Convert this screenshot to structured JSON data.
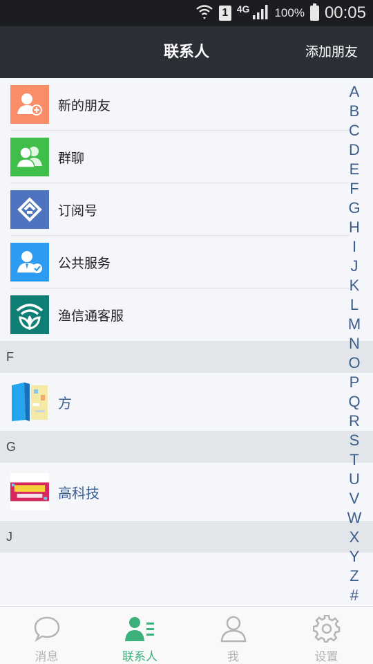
{
  "status_bar": {
    "network": "4G",
    "sim_slot": "1",
    "battery": "100%",
    "time": "00:05"
  },
  "header": {
    "title": "联系人",
    "add_friend_label": "添加朋友"
  },
  "special_items": [
    {
      "label": "新的朋友",
      "icon": "add-friend-icon",
      "color": "#fa8c67"
    },
    {
      "label": "群聊",
      "icon": "group-chat-icon",
      "color": "#3fbf4a"
    },
    {
      "label": "订阅号",
      "icon": "subscription-icon",
      "color": "#4e74bf"
    },
    {
      "label": "公共服务",
      "icon": "public-service-icon",
      "color": "#2d9bf0"
    },
    {
      "label": "渔信通客服",
      "icon": "customer-service-icon",
      "color": "#0f7f75"
    }
  ],
  "sections": [
    {
      "letter": "F",
      "contacts": [
        {
          "name": "方"
        }
      ]
    },
    {
      "letter": "G",
      "contacts": [
        {
          "name": "高科技"
        }
      ]
    },
    {
      "letter": "J",
      "contacts": []
    }
  ],
  "index_letters": [
    "A",
    "B",
    "C",
    "D",
    "E",
    "F",
    "G",
    "H",
    "I",
    "J",
    "K",
    "L",
    "M",
    "N",
    "O",
    "P",
    "Q",
    "R",
    "S",
    "T",
    "U",
    "V",
    "W",
    "X",
    "Y",
    "Z",
    "#"
  ],
  "bottom_nav": [
    {
      "label": "消息",
      "icon": "chat-bubble-icon",
      "active": false
    },
    {
      "label": "联系人",
      "icon": "contacts-icon",
      "active": true
    },
    {
      "label": "我",
      "icon": "person-icon",
      "active": false
    },
    {
      "label": "设置",
      "icon": "gear-icon",
      "active": false
    }
  ],
  "colors": {
    "header_bg": "#2c2f36",
    "accent": "#3daf7a",
    "link": "#3a5f95"
  }
}
